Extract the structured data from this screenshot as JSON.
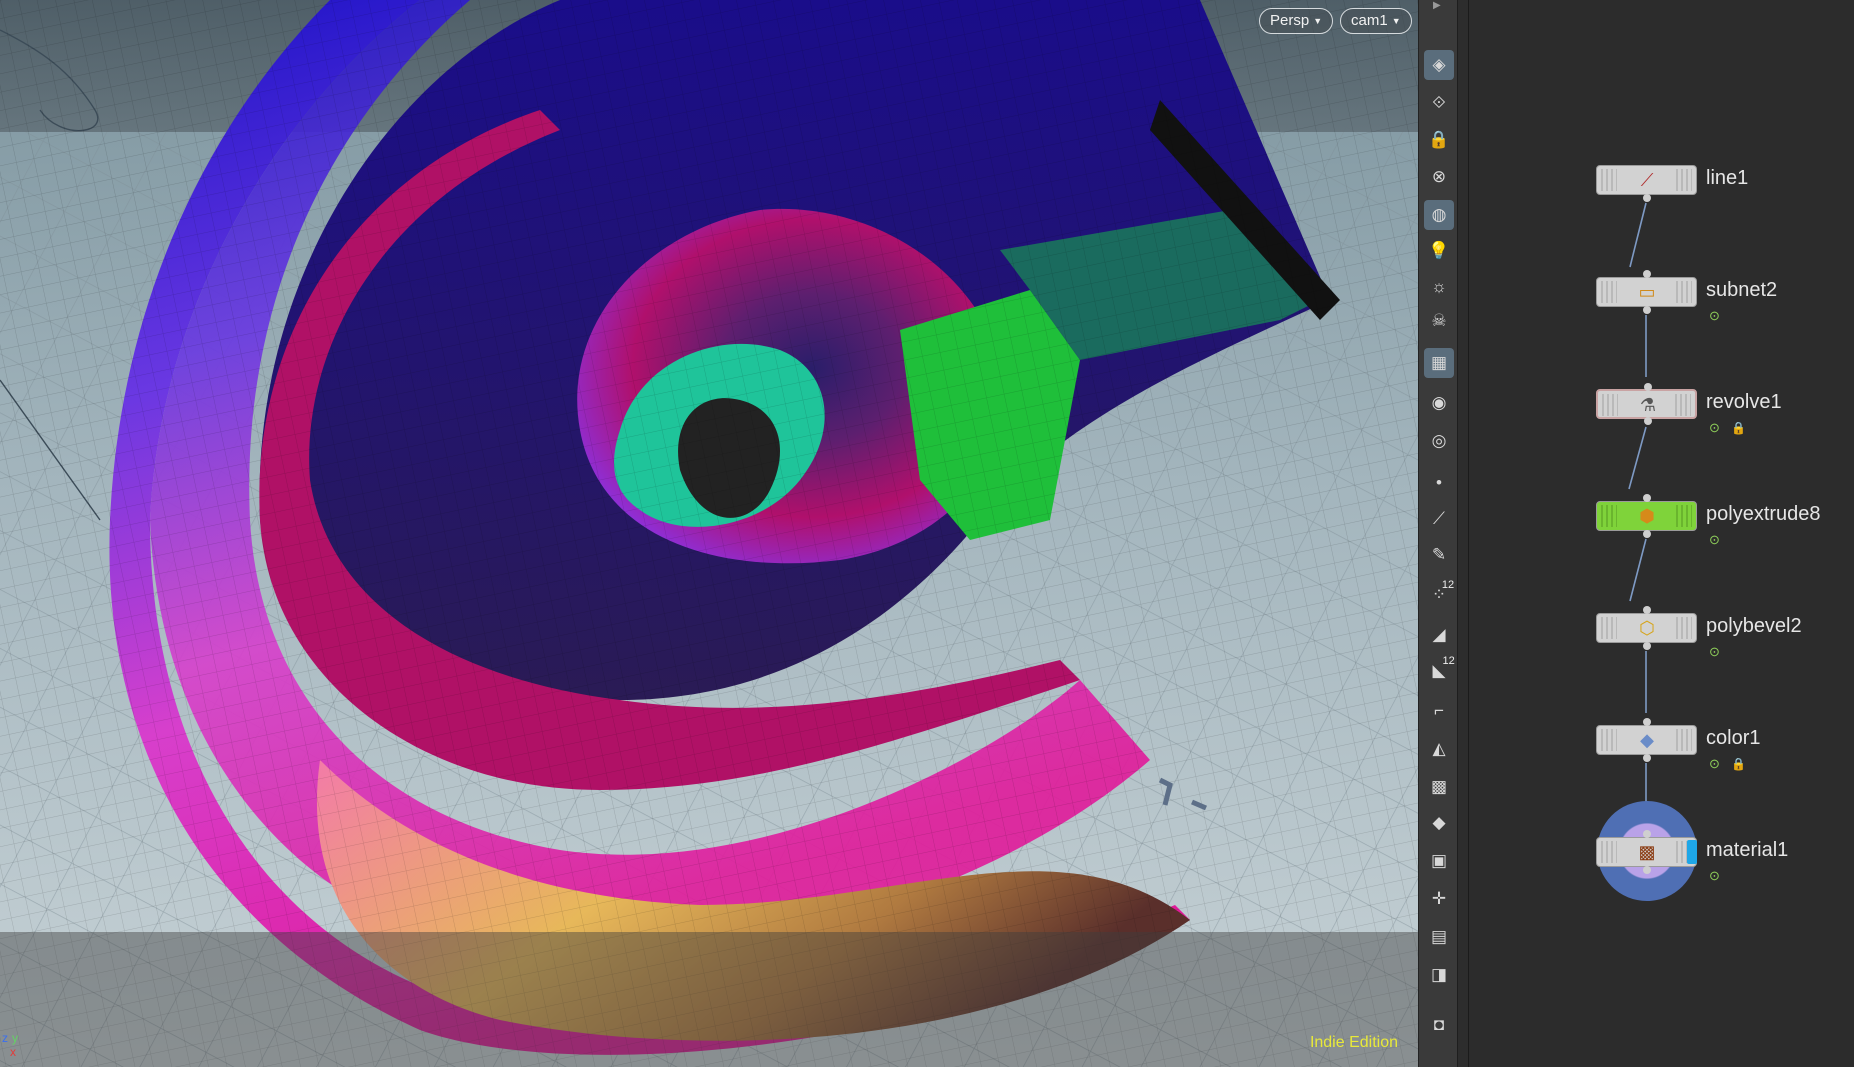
{
  "viewport": {
    "view_menu": "Persp",
    "camera_menu": "cam1",
    "edition_label": "Indie Edition",
    "axis_labels": {
      "x": "x",
      "y": "y",
      "z": "z"
    },
    "colors": {
      "edition": "#e8e93a",
      "selection": "#5a6d7c"
    }
  },
  "toolbar": {
    "items": [
      {
        "icon": "select-mode-icon",
        "active": true
      },
      {
        "icon": "snap-icon",
        "active": false
      },
      {
        "icon": "lock-icon",
        "active": false
      },
      {
        "icon": "close-circle-icon",
        "active": false
      },
      {
        "icon": "speed-dial-icon",
        "active": true
      },
      {
        "icon": "light-bulb-icon",
        "active": false
      },
      {
        "icon": "light-bulb-on-icon",
        "active": false
      },
      {
        "icon": "skull-icon",
        "active": false
      },
      {
        "icon": "checker-shading-icon",
        "active": true
      },
      {
        "icon": "eye-icon",
        "active": false
      },
      {
        "icon": "camera-eye-icon",
        "active": false
      },
      {
        "icon": "point-icon",
        "active": false
      },
      {
        "icon": "brush-icon",
        "active": false
      },
      {
        "icon": "pen-icon",
        "active": false
      },
      {
        "icon": "point-numbers-icon",
        "label": "12",
        "active": false
      },
      {
        "icon": "prim-display-icon",
        "active": false
      },
      {
        "icon": "prim-numbers-icon",
        "label": "12",
        "active": false
      },
      {
        "icon": "normals-icon",
        "active": false
      },
      {
        "icon": "fill-icon",
        "active": false
      },
      {
        "icon": "texture-icon",
        "active": false
      },
      {
        "icon": "diamond-icon",
        "active": false
      },
      {
        "icon": "frame-icon",
        "active": false
      },
      {
        "icon": "handles-icon",
        "active": false
      },
      {
        "icon": "display-icon",
        "active": false
      },
      {
        "icon": "background-image-icon",
        "active": false
      },
      {
        "icon": "camera-icon",
        "active": false
      }
    ]
  },
  "network": {
    "nodes": [
      {
        "label": "line1",
        "icon": "line-icon",
        "color": "#d2d2d2",
        "display_flag": false,
        "locked": false
      },
      {
        "label": "subnet2",
        "icon": "subnet-icon",
        "color": "#d2d2d2",
        "display_flag": true,
        "locked": false
      },
      {
        "label": "revolve1",
        "icon": "revolve-icon",
        "color": "#d2d2d2",
        "display_flag": true,
        "locked": true,
        "selected": true
      },
      {
        "label": "polyextrude8",
        "icon": "polyextrude-icon",
        "color": "#7fd33a",
        "display_flag": true,
        "locked": false
      },
      {
        "label": "polybevel2",
        "icon": "polybevel-icon",
        "color": "#d2d2d2",
        "display_flag": true,
        "locked": false
      },
      {
        "label": "color1",
        "icon": "color-icon",
        "color": "#d2d2d2",
        "display_flag": true,
        "locked": true
      },
      {
        "label": "material1",
        "icon": "material-icon",
        "color": "#d2d2d2",
        "display_flag": true,
        "locked": false,
        "render": true
      }
    ]
  }
}
